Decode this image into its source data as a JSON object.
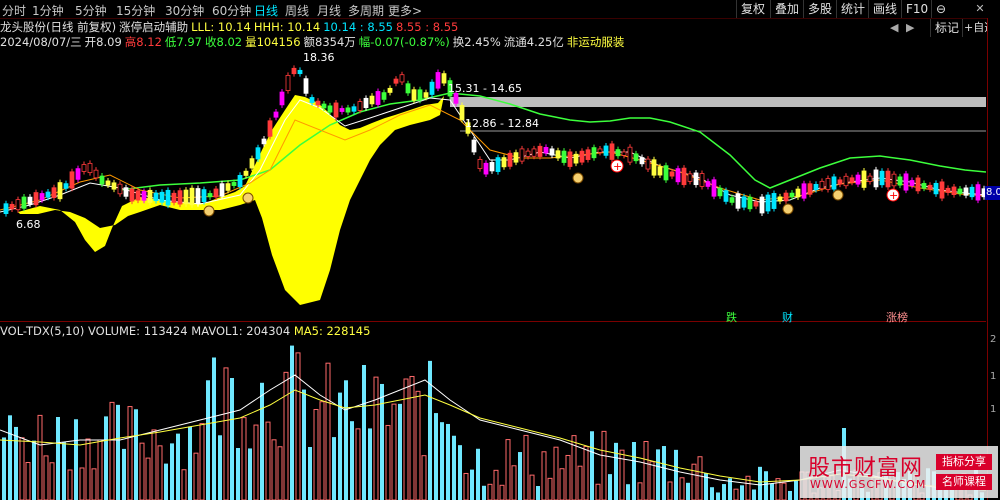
{
  "toolbar": {
    "periods": [
      "分时",
      "1分钟",
      "5分钟",
      "15分钟",
      "30分钟",
      "60分钟",
      "日线",
      "周线",
      "月线",
      "多周期",
      "更多>"
    ],
    "active_period": "日线",
    "buttons": [
      "复权",
      "叠加",
      "多股",
      "统计",
      "画线",
      "F10",
      "标记",
      "+自选"
    ],
    "window": [
      "⊖",
      "✕"
    ],
    "arrows": [
      "◀",
      "▶"
    ]
  },
  "info": {
    "stock": "龙头股份(日线 前复权)",
    "indicator": "涨停启动辅助",
    "lll_label": "LLL: 10.14",
    "hhh_label": "HHH: 10.14",
    "range1": "10.14 : 8.55",
    "range2": "8.55 : 8.55",
    "date": "2024/08/07/三",
    "open": "开8.09",
    "high": "高8.12",
    "low": "低7.97",
    "close": "收8.02",
    "volume": "量104156",
    "amount": "额8354万",
    "change": "幅-0.07(-0.87%)",
    "turnover": "换2.45%",
    "float": "流通4.25亿",
    "sector": "非运动服装"
  },
  "annotations": {
    "high_label": "18.36",
    "low_label": "6.68",
    "band1": "15.31 - 14.65",
    "band2": "12.86 - 12.84",
    "last_price": "8.0",
    "events": [
      "跌",
      "财",
      "涨榜"
    ]
  },
  "volume": {
    "title": "VOL-TDX(5,10)",
    "volume": "VOLUME: 113424",
    "mavol1": "MAVOL1: 204304",
    "ma5": "MA5: 228145",
    "axis_ticks": [
      "2",
      "1",
      "1"
    ]
  },
  "watermark": {
    "title": "股市财富网",
    "url": "WWW.GSCFW.COM",
    "badge1": "指标分享",
    "badge2": "名师课程"
  },
  "colors": {
    "up": "#ff3b3b",
    "down": "#00e5ff",
    "yellow_fill": "#ffff00",
    "ma_green": "#3cff3c",
    "magenta": "#ff00ff",
    "gray_band": "#bdbdbd"
  }
}
